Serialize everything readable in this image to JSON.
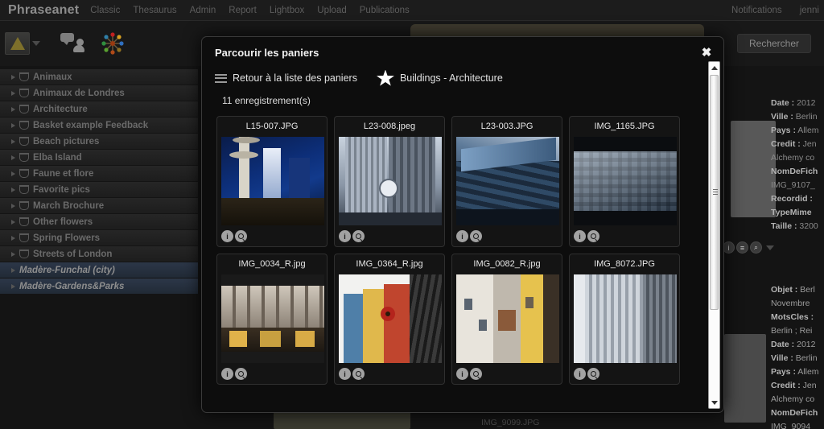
{
  "topbar": {
    "brand": "Phraseanet",
    "nav": [
      {
        "label": "Classic"
      },
      {
        "label": "Thesaurus"
      },
      {
        "label": "Admin"
      },
      {
        "label": "Report"
      },
      {
        "label": "Lightbox"
      },
      {
        "label": "Upload"
      },
      {
        "label": "Publications"
      }
    ],
    "notifications": "Notifications",
    "user": "jenni"
  },
  "toolbar": {
    "thumb_view_icon": "image-icon",
    "chat_icon": "chat-user-icon",
    "share_icon": "network-share-icon",
    "search_button": "Rechercher"
  },
  "baskets": {
    "items": [
      {
        "label": "Animaux",
        "selected": false
      },
      {
        "label": "Animaux de Londres",
        "selected": false
      },
      {
        "label": "Architecture",
        "selected": false
      },
      {
        "label": "Basket example Feedback",
        "selected": false
      },
      {
        "label": "Beach pictures",
        "selected": false
      },
      {
        "label": "Elba Island",
        "selected": false
      },
      {
        "label": "Faune et flore",
        "selected": false
      },
      {
        "label": "Favorite pics",
        "selected": false
      },
      {
        "label": "March Brochure",
        "selected": false
      },
      {
        "label": "Other flowers",
        "selected": false
      },
      {
        "label": "Spring Flowers",
        "selected": false
      },
      {
        "label": "Streets of London",
        "selected": false
      },
      {
        "label": "Madère-Funchal (city)",
        "selected": true
      },
      {
        "label": "Madère-Gardens&Parks",
        "selected": true
      }
    ]
  },
  "metadata_panel_1": {
    "rows": [
      {
        "key": "Date :",
        "value": "2012"
      },
      {
        "key": "Ville :",
        "value": "Berlin"
      },
      {
        "key": "Pays :",
        "value": "Allem"
      },
      {
        "key": "Credit :",
        "value": "Jen"
      },
      {
        "key": "Alchemy co",
        "value": ""
      },
      {
        "key": "NomDeFich",
        "value": ""
      },
      {
        "key": "",
        "value": "IMG_9107_"
      },
      {
        "key": "Recordid :",
        "value": ""
      },
      {
        "key": "TypeMime",
        "value": ""
      },
      {
        "key": "Taille :",
        "value": "3200"
      }
    ]
  },
  "metadata_panel_2": {
    "rows": [
      {
        "key": "Objet :",
        "value": "Berl"
      },
      {
        "key": "",
        "value": "Novembre"
      },
      {
        "key": "MotsCles :",
        "value": ""
      },
      {
        "key": "",
        "value": "Berlin ; Rei"
      },
      {
        "key": "Date :",
        "value": "2012"
      },
      {
        "key": "Ville :",
        "value": "Berlin"
      },
      {
        "key": "Pays :",
        "value": "Allem"
      },
      {
        "key": "Credit :",
        "value": "Jen"
      },
      {
        "key": "Alchemy co",
        "value": ""
      },
      {
        "key": "NomDeFich",
        "value": ""
      },
      {
        "key": "",
        "value": "IMG_9094"
      }
    ]
  },
  "background_record": {
    "field_label": "NomDeFichier :",
    "field_value": "IMG_9099.JPG"
  },
  "modal": {
    "title": "Parcourir les paniers",
    "close_label": "✖",
    "back_link": "Retour à la liste des paniers",
    "basket_name": "Buildings - Architecture",
    "record_count": "11 enregistrement(s)",
    "star_icon": "star-icon",
    "menu_icon": "hamburger-icon",
    "items": [
      {
        "filename": "L15-007.JPG",
        "image": "skyscraper-blue-sky",
        "info_icon": "info-icon",
        "zoom_icon": "magnifier-icon"
      },
      {
        "filename": "L23-008.jpeg",
        "image": "glass-tower-clock",
        "info_icon": "info-icon",
        "zoom_icon": "magnifier-icon"
      },
      {
        "filename": "L23-003.JPG",
        "image": "modern-facade-blue",
        "info_icon": "info-icon",
        "zoom_icon": "magnifier-icon"
      },
      {
        "filename": "IMG_1165.JPG",
        "image": "glass-office-grid",
        "info_icon": "info-icon",
        "zoom_icon": "magnifier-icon"
      },
      {
        "filename": "IMG_0034_R.jpg",
        "image": "street-shopfront",
        "info_icon": "info-icon",
        "zoom_icon": "magnifier-icon"
      },
      {
        "filename": "IMG_0364_R.jpg",
        "image": "colorful-houses",
        "info_icon": "info-icon",
        "zoom_icon": "magnifier-icon"
      },
      {
        "filename": "IMG_0082_R.jpg",
        "image": "old-town-alley",
        "info_icon": "info-icon",
        "zoom_icon": "magnifier-icon"
      },
      {
        "filename": "IMG_8072.JPG",
        "image": "grey-glass-tower",
        "info_icon": "info-icon",
        "zoom_icon": "magnifier-icon"
      }
    ],
    "scrollbar": {
      "up_icon": "scroll-up-arrow",
      "down_icon": "scroll-down-arrow",
      "thumb": "scroll-thumb"
    }
  },
  "colors": {
    "modal_bg": "#0d0d0d",
    "page_bg": "#141414",
    "selected_basket": "#2c3748",
    "text_primary": "#e8e8e8"
  }
}
